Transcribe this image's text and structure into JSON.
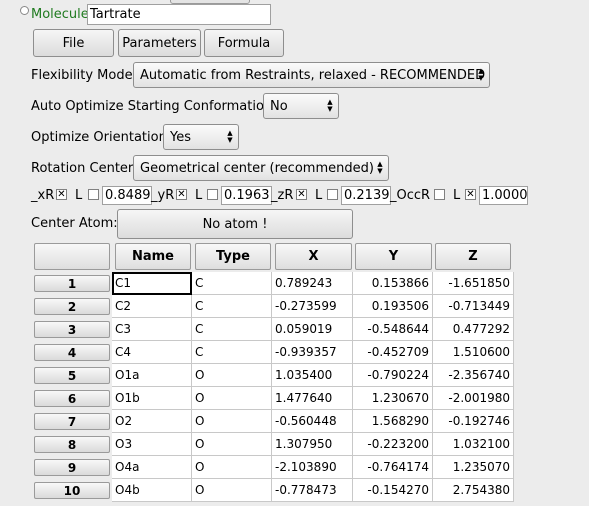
{
  "header": {
    "molecule_label": "Molecule",
    "molecule_name": "Tartrate"
  },
  "buttons": {
    "file": "File",
    "parameters": "Parameters",
    "formula": "Formula",
    "center_atom": "No atom !"
  },
  "options": {
    "flexibility_label": "Flexibility Model",
    "flexibility_value": "Automatic from Restraints, relaxed - RECOMMENDED",
    "auto_optimize_label": "Auto Optimize Starting Conformation",
    "auto_optimize_value": "No",
    "optimize_orientation_label": "Optimize Orientation",
    "optimize_orientation_value": "Yes",
    "rotation_center_label": "Rotation Center",
    "rotation_center_value": "Geometrical center (recommended)",
    "center_atom_label": "Center Atom:"
  },
  "params": {
    "xR_label": "_xR",
    "xR_checked": "✕",
    "xR_L": "L",
    "xR_value": "0.8489",
    "yR_label": "_yR",
    "yR_checked": "✕",
    "yR_L": "L",
    "yR_value": "0.1963",
    "zR_label": "_zR",
    "zR_checked": "✕",
    "zR_L": "L",
    "zR_value": "0.2139",
    "occR_label": "_OccR",
    "occR_L": "L",
    "occR_L_checked": "✕",
    "occR_value": "1.0000"
  },
  "table": {
    "columns": [
      "Name",
      "Type",
      "X",
      "Y",
      "Z"
    ],
    "rows": [
      {
        "index": "1",
        "name": "C1",
        "type": "C",
        "x": "0.789243",
        "y": "0.153866",
        "z": "-1.651850"
      },
      {
        "index": "2",
        "name": "C2",
        "type": "C",
        "x": "-0.273599",
        "y": "0.193506",
        "z": "-0.713449"
      },
      {
        "index": "3",
        "name": "C3",
        "type": "C",
        "x": "0.059019",
        "y": "-0.548644",
        "z": "0.477292"
      },
      {
        "index": "4",
        "name": "C4",
        "type": "C",
        "x": "-0.939357",
        "y": "-0.452709",
        "z": "1.510600"
      },
      {
        "index": "5",
        "name": "O1a",
        "type": "O",
        "x": "1.035400",
        "y": "-0.790224",
        "z": "-2.356740"
      },
      {
        "index": "6",
        "name": "O1b",
        "type": "O",
        "x": "1.477640",
        "y": "1.230670",
        "z": "-2.001980"
      },
      {
        "index": "7",
        "name": "O2",
        "type": "O",
        "x": "-0.560448",
        "y": "1.568290",
        "z": "-0.192746"
      },
      {
        "index": "8",
        "name": "O3",
        "type": "O",
        "x": "1.307950",
        "y": "-0.223200",
        "z": "1.032100"
      },
      {
        "index": "9",
        "name": "O4a",
        "type": "O",
        "x": "-2.103890",
        "y": "-0.764174",
        "z": "1.235070"
      },
      {
        "index": "10",
        "name": "O4b",
        "type": "O",
        "x": "-0.778473",
        "y": "-0.154270",
        "z": "2.754380"
      }
    ]
  }
}
